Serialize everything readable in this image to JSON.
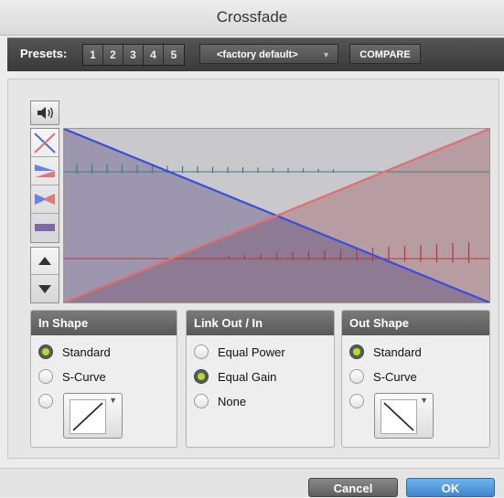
{
  "window": {
    "title": "Crossfade"
  },
  "presets": {
    "label": "Presets:",
    "slots": [
      "1",
      "2",
      "3",
      "4",
      "5"
    ],
    "selected": "<factory default>",
    "compare_label": "COMPARE"
  },
  "tools": {
    "speaker_icon": "speaker-icon",
    "shape_buttons": [
      "x-shape-icon",
      "fade-in-shape-icon",
      "bowtie-shape-icon",
      "bar-shape-icon"
    ],
    "nav_buttons": [
      "up-arrow-icon",
      "down-arrow-icon"
    ]
  },
  "graph": {
    "fade_out_color": "#3a4fd8",
    "fade_in_color": "#e07070",
    "top_waveform_color": "#3d7f78",
    "bottom_waveform_color": "#b33a3a"
  },
  "in_shape": {
    "title": "In Shape",
    "options": [
      "Standard",
      "S-Curve"
    ],
    "selected": "Standard"
  },
  "link": {
    "title": "Link Out / In",
    "options": [
      "Equal Power",
      "Equal Gain",
      "None"
    ],
    "selected": "Equal Gain"
  },
  "out_shape": {
    "title": "Out Shape",
    "options": [
      "Standard",
      "S-Curve"
    ],
    "selected": "Standard"
  },
  "footer": {
    "cancel_label": "Cancel",
    "ok_label": "OK"
  },
  "colors": {
    "accent_radio": "#a8e22a",
    "ok_button": "#4a90d9"
  }
}
